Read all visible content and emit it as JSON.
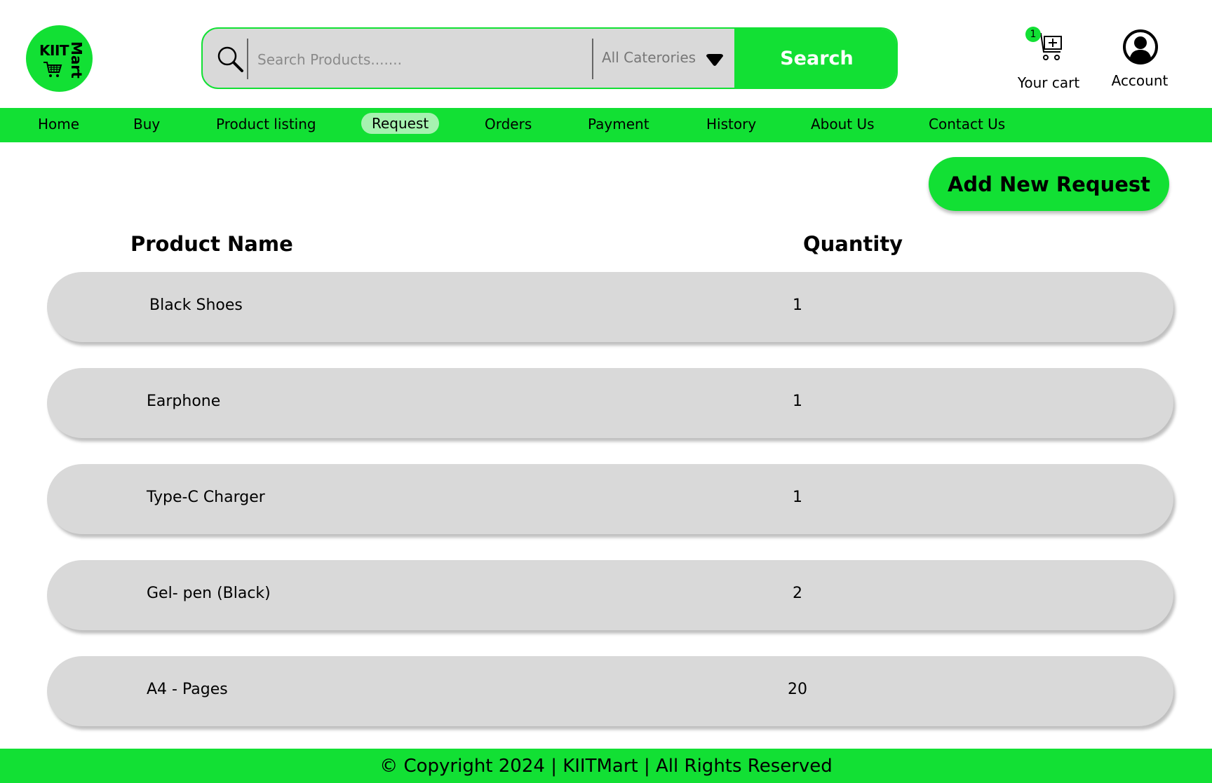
{
  "brand": {
    "logo_line1": "KIIT",
    "logo_line2": "Mart",
    "accent_color": "#12e034"
  },
  "search": {
    "placeholder": "Search Products.......",
    "value": "",
    "category_selected": "All Caterories",
    "button_label": "Search"
  },
  "header": {
    "cart_label": "Your cart",
    "cart_count": "1",
    "account_label": "Account"
  },
  "nav": {
    "items": [
      {
        "label": "Home"
      },
      {
        "label": "Buy"
      },
      {
        "label": "Product listing"
      },
      {
        "label": "Request"
      },
      {
        "label": "Orders"
      },
      {
        "label": "Payment"
      },
      {
        "label": "History"
      },
      {
        "label": "About Us"
      },
      {
        "label": "Contact Us"
      }
    ],
    "active": "Request"
  },
  "main": {
    "add_button_label": "Add New Request",
    "columns": {
      "name": "Product Name",
      "quantity": "Quantity"
    },
    "rows": [
      {
        "name": "Black Shoes",
        "quantity": "1"
      },
      {
        "name": "Earphone",
        "quantity": "1"
      },
      {
        "name": "Type-C Charger",
        "quantity": "1"
      },
      {
        "name": "Gel- pen (Black)",
        "quantity": "2"
      },
      {
        "name": "A4 - Pages",
        "quantity": "20"
      }
    ]
  },
  "footer": {
    "text": "© Copyright 2024 | KIITMart | All Rights Reserved"
  },
  "icons": [
    "magnifier-icon",
    "chevron-down-icon",
    "cart-icon",
    "account-icon",
    "logo-cart-icon"
  ]
}
